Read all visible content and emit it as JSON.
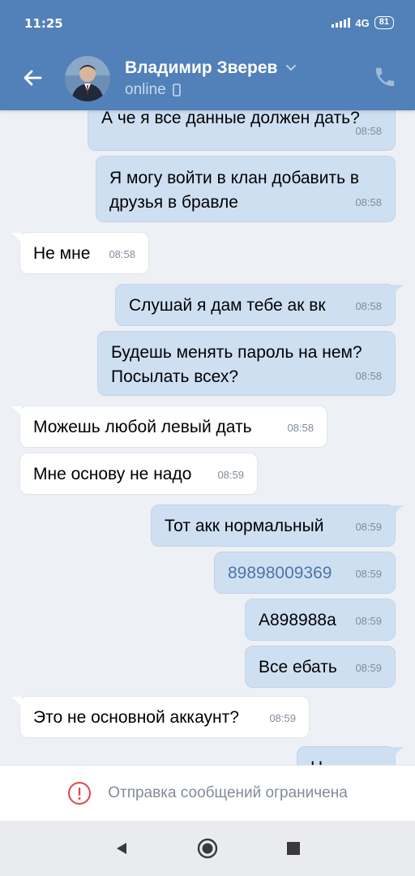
{
  "status_bar": {
    "time": "11:25",
    "network": "4G",
    "battery": "81"
  },
  "header": {
    "contact_name": "Владимир Зверев",
    "status": "online"
  },
  "messages": [
    {
      "dir": "out",
      "text": "А че я все данные должен дать?",
      "time": "08:58"
    },
    {
      "dir": "out",
      "text": "Я могу войти в клан добавить в друзья в бравле",
      "time": "08:58"
    },
    {
      "dir": "in",
      "text": "Не мне",
      "time": "08:58"
    },
    {
      "dir": "out",
      "text": "Слушай я дам тебе ак вк",
      "time": "08:58"
    },
    {
      "dir": "out",
      "text": "Будешь менять пароль на нем? Посылать всех?",
      "time": "08:58"
    },
    {
      "dir": "in",
      "text": "Можешь любой левый дать",
      "time": "08:58"
    },
    {
      "dir": "in",
      "text": "Мне основу не надо",
      "time": "08:59"
    },
    {
      "dir": "out",
      "text": "Тот акк нормальный",
      "time": "08:59"
    },
    {
      "dir": "out",
      "text": "89898009369",
      "time": "08:59",
      "link": true
    },
    {
      "dir": "out",
      "text": "А898988а",
      "time": "08:59"
    },
    {
      "dir": "out",
      "text": "Все ебать",
      "time": "08:59"
    },
    {
      "dir": "in",
      "text": "Это не основной аккаунт?",
      "time": "08:59"
    },
    {
      "dir": "out",
      "text": "Н",
      "time": ""
    }
  ],
  "restricted_banner": {
    "text": "Отправка сообщений ограничена"
  },
  "colors": {
    "brand": "#5181b8",
    "outgoing_bubble": "#cfdff2",
    "incoming_bubble": "#ffffff",
    "warning": "#e64646"
  }
}
